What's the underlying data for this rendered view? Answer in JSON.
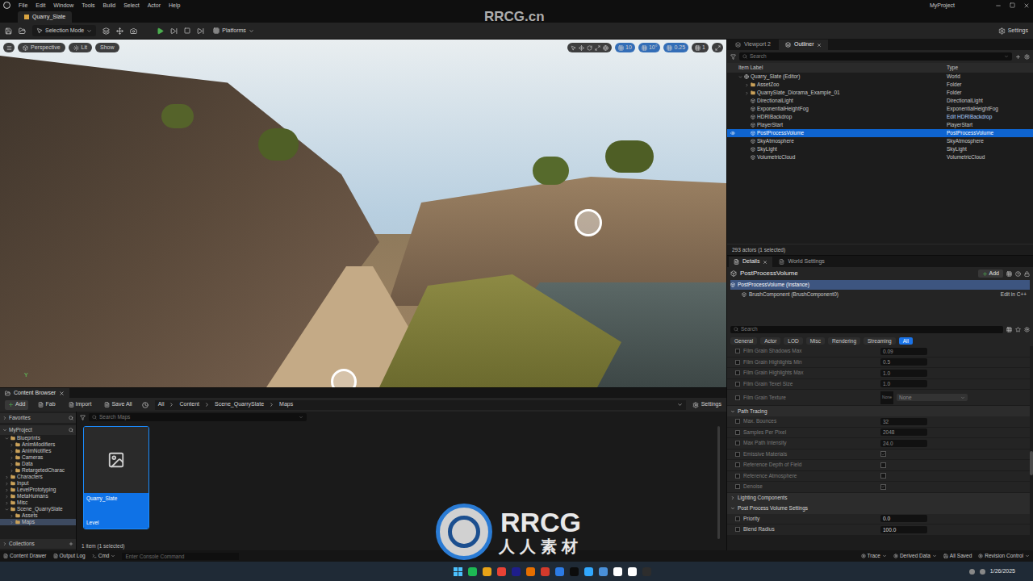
{
  "window": {
    "title": "MyProject",
    "doc_tab": "Quarry_Slate"
  },
  "menu": [
    "File",
    "Edit",
    "Window",
    "Tools",
    "Build",
    "Select",
    "Actor",
    "Help"
  ],
  "watermarks": {
    "top": "RRCG.cn",
    "logo_main": "RRCG",
    "logo_sub": "人人素材"
  },
  "toolbar": {
    "mode": "Selection Mode",
    "platforms": "Platforms",
    "settings": "Settings"
  },
  "viewport": {
    "view": "Perspective",
    "lighting": "Lit",
    "show": "Show",
    "snap_values": [
      "10",
      "10°",
      "0.25",
      "1"
    ],
    "axis_label": "Y"
  },
  "outliner": {
    "tabs": [
      {
        "label": "Viewport 2",
        "selected": false
      },
      {
        "label": "Outliner",
        "selected": true
      }
    ],
    "search": {
      "placeholder": "Search"
    },
    "columns": [
      "Item Label",
      "Type"
    ],
    "rows": [
      {
        "name": "Quarry_Slate (Editor)",
        "type": "World",
        "depth": 0,
        "kind": "world",
        "expanded": true,
        "selected": false,
        "type_link": false
      },
      {
        "name": "AssetZoo",
        "type": "Folder",
        "depth": 1,
        "kind": "folder",
        "expanded": false,
        "selected": false,
        "type_link": false
      },
      {
        "name": "QuarrySlate_Diorama_Example_01",
        "type": "Folder",
        "depth": 1,
        "kind": "folder",
        "expanded": false,
        "selected": false,
        "type_link": false
      },
      {
        "name": "DirectionalLight",
        "type": "DirectionalLight",
        "depth": 1,
        "kind": "actor",
        "expanded": false,
        "selected": false,
        "type_link": false
      },
      {
        "name": "ExponentialHeightFog",
        "type": "ExponentialHeightFog",
        "depth": 1,
        "kind": "actor",
        "expanded": false,
        "selected": false,
        "type_link": false
      },
      {
        "name": "HDRIBackdrop",
        "type": "Edit HDRIBackdrop",
        "depth": 1,
        "kind": "actor",
        "expanded": false,
        "selected": false,
        "type_link": true
      },
      {
        "name": "PlayerStart",
        "type": "PlayerStart",
        "depth": 1,
        "kind": "actor",
        "expanded": false,
        "selected": false,
        "type_link": false
      },
      {
        "name": "PostProcessVolume",
        "type": "PostProcessVolume",
        "depth": 1,
        "kind": "actor",
        "expanded": false,
        "selected": true,
        "type_link": false
      },
      {
        "name": "SkyAtmosphere",
        "type": "SkyAtmosphere",
        "depth": 1,
        "kind": "actor",
        "expanded": false,
        "selected": false,
        "type_link": false
      },
      {
        "name": "SkyLight",
        "type": "SkyLight",
        "depth": 1,
        "kind": "actor",
        "expanded": false,
        "selected": false,
        "type_link": false
      },
      {
        "name": "VolumetricCloud",
        "type": "VolumetricCloud",
        "depth": 1,
        "kind": "actor",
        "expanded": false,
        "selected": false,
        "type_link": false
      }
    ],
    "footer": "293 actors (1 selected)"
  },
  "details": {
    "tabs": [
      {
        "label": "Details",
        "selected": true
      },
      {
        "label": "World Settings",
        "selected": false
      }
    ],
    "actor": "PostProcessVolume",
    "add_button": "Add",
    "components": [
      {
        "name": "PostProcessVolume (Instance)",
        "selected": true,
        "action": ""
      },
      {
        "name": "BrushComponent (BrushComponent0)",
        "selected": false,
        "action": "Edit in C++"
      }
    ],
    "search": {
      "placeholder": "Search"
    },
    "filters": [
      {
        "label": "General",
        "selected": false
      },
      {
        "label": "Actor",
        "selected": false
      },
      {
        "label": "LOD",
        "selected": false
      },
      {
        "label": "Misc",
        "selected": false
      },
      {
        "label": "Rendering",
        "selected": false
      },
      {
        "label": "Streaming",
        "selected": false
      },
      {
        "label": "All",
        "selected": true
      }
    ],
    "properties": [
      {
        "label": "Film Grain Shadows Max",
        "value": "0.09",
        "kind": "number",
        "enabled": false
      },
      {
        "label": "Film Grain Highlights Min",
        "value": "0.5",
        "kind": "number",
        "enabled": false
      },
      {
        "label": "Film Grain Highlights Max",
        "value": "1.0",
        "kind": "number",
        "enabled": false
      },
      {
        "label": "Film Grain Texel Size",
        "value": "1.0",
        "kind": "number",
        "enabled": false
      },
      {
        "label": "Film Grain Texture",
        "value": "None",
        "thumb": "None",
        "kind": "texture",
        "enabled": false
      },
      {
        "label": "Path Tracing",
        "kind": "section",
        "expanded": true
      },
      {
        "label": "Max. Bounces",
        "value": "32",
        "kind": "number",
        "enabled": false
      },
      {
        "label": "Samples Per Pixel",
        "value": "2048",
        "kind": "number",
        "enabled": false
      },
      {
        "label": "Max Path Intensity",
        "value": "24.0",
        "kind": "number",
        "enabled": false
      },
      {
        "label": "Emissive Materials",
        "checked": true,
        "kind": "checkbox",
        "enabled": false
      },
      {
        "label": "Reference Depth of Field",
        "checked": false,
        "kind": "checkbox",
        "enabled": false
      },
      {
        "label": "Reference Atmosphere",
        "checked": false,
        "kind": "checkbox",
        "enabled": false
      },
      {
        "label": "Denoise",
        "checked": true,
        "kind": "checkbox",
        "enabled": false
      },
      {
        "label": "Lighting Components",
        "kind": "section",
        "expanded": false
      },
      {
        "label": "Post Process Volume Settings",
        "kind": "section",
        "expanded": true
      },
      {
        "label": "Priority",
        "value": "0.0",
        "kind": "number",
        "enabled": true
      },
      {
        "label": "Blend Radius",
        "value": "100.0",
        "kind": "number",
        "enabled": true
      }
    ]
  },
  "content_browser": {
    "tab": "Content Browser",
    "buttons": [
      "Add",
      "Fab",
      "Import",
      "Save All"
    ],
    "breadcrumb": [
      "All",
      "Content",
      "Scene_QuarrySlate",
      "Maps"
    ],
    "settings": "Settings",
    "favorites": "Favorites",
    "project": "MyProject",
    "tree": [
      {
        "label": "Blueprints",
        "depth": 1,
        "expanded": true,
        "selected": false
      },
      {
        "label": "AnimModifiers",
        "depth": 2,
        "expanded": false,
        "selected": false
      },
      {
        "label": "AnimNotifies",
        "depth": 2,
        "expanded": false,
        "selected": false
      },
      {
        "label": "Cameras",
        "depth": 2,
        "expanded": false,
        "selected": false
      },
      {
        "label": "Data",
        "depth": 2,
        "expanded": false,
        "selected": false
      },
      {
        "label": "RetargetedCharac",
        "depth": 2,
        "expanded": false,
        "selected": false
      },
      {
        "label": "Characters",
        "depth": 1,
        "expanded": false,
        "selected": false
      },
      {
        "label": "Input",
        "depth": 1,
        "expanded": false,
        "selected": false
      },
      {
        "label": "LevelPrototyping",
        "depth": 1,
        "expanded": false,
        "selected": false
      },
      {
        "label": "MetaHumans",
        "depth": 1,
        "expanded": false,
        "selected": false
      },
      {
        "label": "Misc",
        "depth": 1,
        "expanded": false,
        "selected": false
      },
      {
        "label": "Scene_QuarrySlate",
        "depth": 1,
        "expanded": true,
        "selected": false
      },
      {
        "label": "Assets",
        "depth": 2,
        "expanded": false,
        "selected": false
      },
      {
        "label": "Maps",
        "depth": 2,
        "expanded": false,
        "selected": true
      }
    ],
    "collections": "Collections",
    "search": {
      "placeholder": "Search Maps"
    },
    "assets": [
      {
        "name": "Quarry_Slate",
        "type": "Level",
        "selected": true
      }
    ],
    "footer": "1 item (1 selected)"
  },
  "status_bar": {
    "left": [
      "Content Drawer",
      "Output Log",
      "Cmd"
    ],
    "console_placeholder": "Enter Console Command",
    "right": [
      "Trace",
      "Derived Data",
      "All Saved",
      "Revision Control"
    ]
  },
  "taskbar": {
    "date": "1/26/2025",
    "apps": [
      "#1db954",
      "#e8a317",
      "#e94235",
      "#1e1e8c",
      "#e66f00",
      "#d33a2c",
      "#2c7be5",
      "#0c0c0c",
      "#31a8ff",
      "#4a90d9",
      "#ffffff",
      "#ffffff",
      "#2d2d2d"
    ]
  }
}
